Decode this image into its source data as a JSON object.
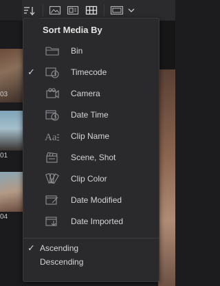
{
  "toolbar": {
    "icons": [
      "sort-icon",
      "thumbnail-view-icon",
      "filmstrip-view-icon",
      "list-view-icon",
      "metadata-view-icon",
      "chevron-down-icon"
    ]
  },
  "background": {
    "clip_labels": [
      "03",
      "01",
      "04"
    ]
  },
  "menu": {
    "title": "Sort Media By",
    "items": [
      {
        "label": "Bin",
        "icon": "folder-icon",
        "checked": false
      },
      {
        "label": "Timecode",
        "icon": "timecode-icon",
        "checked": true
      },
      {
        "label": "Camera",
        "icon": "camera-icon",
        "checked": false
      },
      {
        "label": "Date Time",
        "icon": "calendar-clock-icon",
        "checked": false
      },
      {
        "label": "Clip Name",
        "icon": "text-icon",
        "checked": false
      },
      {
        "label": "Scene, Shot",
        "icon": "clapper-icon",
        "checked": false
      },
      {
        "label": "Clip Color",
        "icon": "color-swatch-icon",
        "checked": false
      },
      {
        "label": "Date Modified",
        "icon": "calendar-edit-icon",
        "checked": false
      },
      {
        "label": "Date Imported",
        "icon": "calendar-import-icon",
        "checked": false
      }
    ],
    "check_glyph": "✓",
    "order": [
      {
        "label": "Ascending",
        "checked": true
      },
      {
        "label": "Descending",
        "checked": false
      }
    ]
  },
  "colors": {
    "menu_bg": "#2a2a2d",
    "text": "#d6d6d6",
    "icon": "#8f8f94"
  }
}
